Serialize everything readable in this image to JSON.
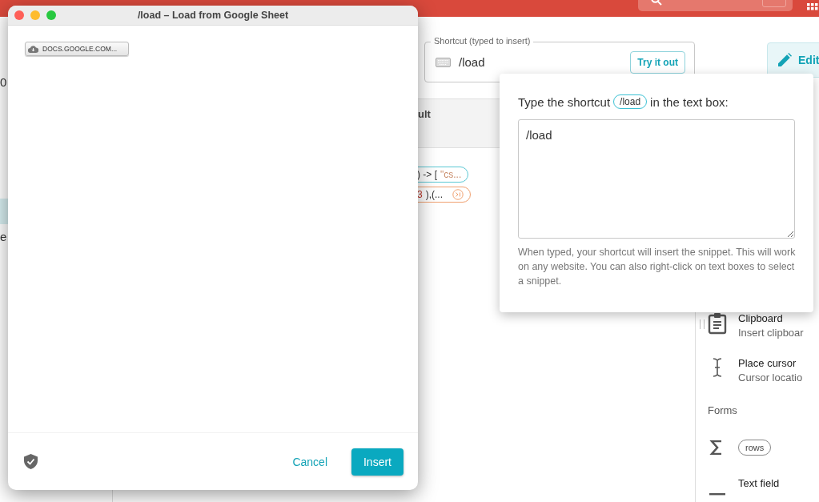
{
  "sidebar": {
    "items": [
      {
        "label": "0",
        "selected": false
      },
      {
        "selected": true
      },
      {
        "label": "e",
        "selected": false
      }
    ]
  },
  "shortcut": {
    "label": "Shortcut (typed to insert)",
    "value": "/load",
    "try_button": "Try it out"
  },
  "edit_button": "Edit",
  "table": {
    "column_1": "ult",
    "chips": [
      {
        "color": "#5bc8d4",
        "end_icon": false,
        "segments": [
          {
            "kind": "code",
            "text": ") -> ["
          },
          {
            "kind": "string",
            "text": "\"cs..."
          }
        ]
      },
      {
        "color": "#f0a070",
        "end_icon": true,
        "segments": [
          {
            "kind": "number",
            "text": "3"
          },
          {
            "kind": "code",
            "text": "),(..."
          }
        ]
      }
    ]
  },
  "popup": {
    "prompt_before": "Type the shortcut",
    "shortcut_chip": "/load",
    "prompt_after": "in the text box:",
    "textarea_value": "/load",
    "help": "When typed, your shortcut will insert the snippet. This will work on any website. You can also right-click on text boxes to select a snippet."
  },
  "panel": {
    "items": [
      {
        "kind": "clipboard",
        "title": "Clipboard",
        "subtitle": "Insert clipboar"
      },
      {
        "kind": "cursor",
        "title": "Place cursor",
        "subtitle": "Cursor locatio"
      },
      {
        "kind": "heading",
        "title": "Forms"
      },
      {
        "kind": "formula",
        "chip": "rows"
      },
      {
        "kind": "textfield",
        "title": "Text field"
      }
    ]
  },
  "dialog": {
    "title": "/load – Load from Google Sheet",
    "source_button": "DOCS.GOOGLE.COM...",
    "cancel": "Cancel",
    "insert": "Insert"
  }
}
